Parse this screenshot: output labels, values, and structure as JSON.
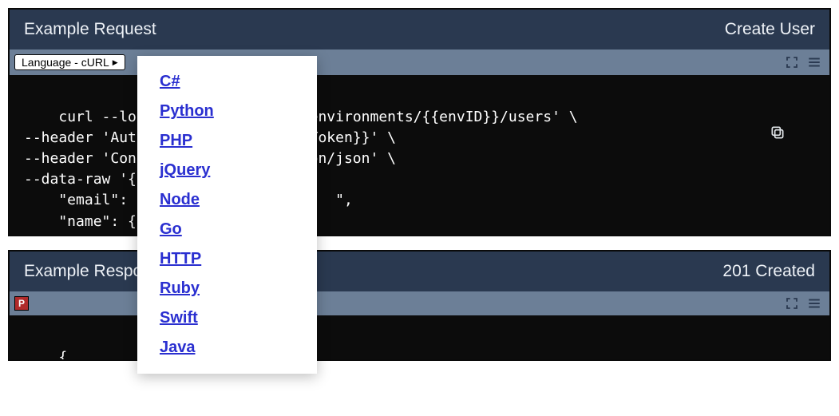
{
  "request_panel": {
    "title_left": "Example Request",
    "title_right": "Create User",
    "language_selector_label": "Language - cURL",
    "code": "curl --location '{{apiPath}}/environments/{{envID}}/users' \\\n--header 'Authorization: {{accessToken}}' \\\n--header 'Content-Type: application/json' \\\n--data-raw '{\n    \"email\": \"ma                    \",\n    \"name\": {\n        \"given\":\n        \"family\""
  },
  "dropdown_items": [
    "C#",
    "Python",
    "PHP",
    "jQuery",
    "Node",
    "Go",
    "HTTP",
    "Ruby",
    "Swift",
    "Java"
  ],
  "response_panel": {
    "title_left": "Example Response",
    "title_right": "201 Created",
    "badge": "P",
    "code": "{"
  }
}
